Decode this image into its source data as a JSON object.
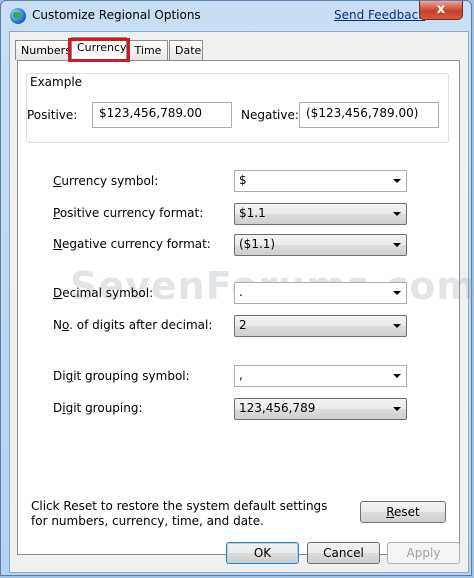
{
  "window": {
    "title": "Customize Regional Options",
    "send_feedback": "Send Feedback",
    "close_label": "x"
  },
  "tabs": [
    {
      "label": "Numbers"
    },
    {
      "label": "Currency"
    },
    {
      "label": "Time"
    },
    {
      "label": "Date"
    }
  ],
  "active_tab": "Currency",
  "example": {
    "title": "Example",
    "positive_label": "Positive:",
    "positive_value": "$123,456,789.00",
    "negative_label": "Negative:",
    "negative_value": "($123,456,789.00)"
  },
  "settings": {
    "currency_symbol": {
      "label_key": "C",
      "label_rest": "urrency symbol:",
      "value": "$"
    },
    "positive_format": {
      "label_key": "P",
      "label_rest": "ositive currency format:",
      "value": "$1.1"
    },
    "negative_format": {
      "label_key": "N",
      "label_rest": "egative currency format:",
      "value": "($1.1)"
    },
    "decimal_symbol": {
      "label_key": "D",
      "label_rest": "ecimal symbol:",
      "value": "."
    },
    "digits_after_decimal": {
      "label_pre": "N",
      "label_key": "o",
      "label_rest": ". of digits after decimal:",
      "value": "2"
    },
    "digit_grouping_symbol": {
      "label_pre": "Di",
      "label_key": "g",
      "label_rest": "it grouping symbol:",
      "value": ","
    },
    "digit_grouping": {
      "label_pre": "D",
      "label_key": "i",
      "label_rest": "git grouping:",
      "value": "123,456,789"
    }
  },
  "watermark": "SevenForums.com",
  "reset_text": "Click Reset to restore the system default settings for numbers, currency, time, and date.",
  "buttons": {
    "reset_key": "R",
    "reset_rest": "eset",
    "ok": "OK",
    "cancel": "Cancel",
    "apply": "Apply"
  },
  "colors": {
    "highlight_box": "#d31920",
    "close_button": "#c7402a",
    "link": "#0b2b8e"
  }
}
